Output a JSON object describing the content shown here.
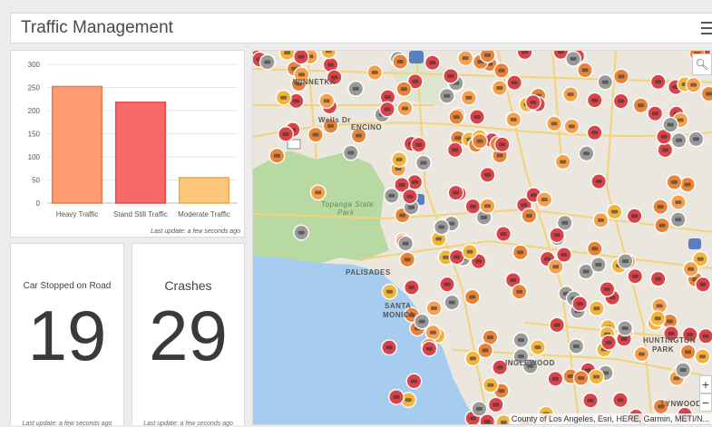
{
  "header": {
    "title": "Traffic Management",
    "menu_icon": "hamburger-menu-icon"
  },
  "chart_panel": {
    "footer": "Last update: a few seconds ago",
    "chart_data": {
      "type": "bar",
      "categories": [
        "Heavy Traffic",
        "Stand Still Traffic",
        "Moderate Traffic"
      ],
      "values": [
        252,
        218,
        55
      ],
      "ylim": [
        0,
        300
      ],
      "yticks": [
        0,
        50,
        100,
        150,
        200,
        250,
        300
      ],
      "grid": true,
      "colors": [
        "#ff9b73",
        "#f86a6a",
        "#fcc77a"
      ],
      "borders": [
        "#e87a4b",
        "#e04a4a",
        "#eaaa4a"
      ]
    }
  },
  "indicators": [
    {
      "title": "Car Stopped on Road",
      "value": "19",
      "footer": "Last update: a few seconds ago"
    },
    {
      "title": "Crashes",
      "value": "29",
      "footer": "Last update: a few seconds ago"
    }
  ],
  "map": {
    "attribution": "County of Los Angeles, Esri, HERE, Garmin, METI/N...",
    "search_icon": "search-icon",
    "zoom_in_label": "+",
    "zoom_out_label": "−",
    "places": [
      {
        "name": "WINNETKA",
        "x": 44,
        "y": 30,
        "green": false
      },
      {
        "name": "ENCINO",
        "x": 108,
        "y": 80,
        "green": false
      },
      {
        "name": "Topanga State",
        "x": 75,
        "y": 165,
        "green": true
      },
      {
        "name": "Park",
        "x": 93,
        "y": 174,
        "green": true
      },
      {
        "name": "PALISADES",
        "x": 102,
        "y": 240,
        "green": false
      },
      {
        "name": "SANTA",
        "x": 145,
        "y": 277,
        "green": false
      },
      {
        "name": "MONICA",
        "x": 143,
        "y": 287,
        "green": false
      },
      {
        "name": "HUNTINGTON",
        "x": 430,
        "y": 315,
        "green": false
      },
      {
        "name": "PARK",
        "x": 440,
        "y": 325,
        "green": false
      },
      {
        "name": "LYNWOOD",
        "x": 450,
        "y": 385,
        "green": false
      },
      {
        "name": "INGLEWOOD",
        "x": 278,
        "y": 340,
        "green": false
      },
      {
        "name": "Wells Dr",
        "x": 72,
        "y": 72,
        "green": false
      }
    ],
    "marker_colors": {
      "crash": "#d9434a",
      "stopped": "#e8843a",
      "hazard": "#f3b43e",
      "congestion": "#f6a04d",
      "gray": "#9a9a9a"
    }
  }
}
